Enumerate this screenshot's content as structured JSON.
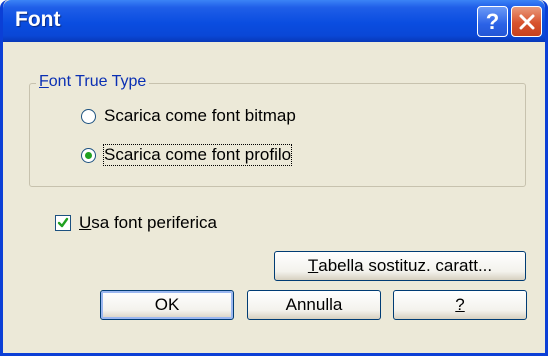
{
  "window": {
    "title": "Font",
    "help_glyph": "?"
  },
  "group": {
    "legend_accel": "F",
    "legend_rest": "ont True Type",
    "radios": [
      {
        "label": "Scarica come font bitmap",
        "checked": false
      },
      {
        "label": "Scarica come font profilo",
        "checked": true
      }
    ]
  },
  "checkbox": {
    "accel": "U",
    "label_rest": "sa font periferica",
    "checked": true
  },
  "buttons": {
    "substitution": {
      "accel": "T",
      "label_rest": "abella sostituz. caratt..."
    },
    "ok": "OK",
    "cancel": "Annulla",
    "help": "?"
  },
  "colors": {
    "titlebar": "#0a4de0",
    "face": "#ece9d8",
    "accent_green": "#21a121",
    "legend": "#0a2fb3"
  }
}
